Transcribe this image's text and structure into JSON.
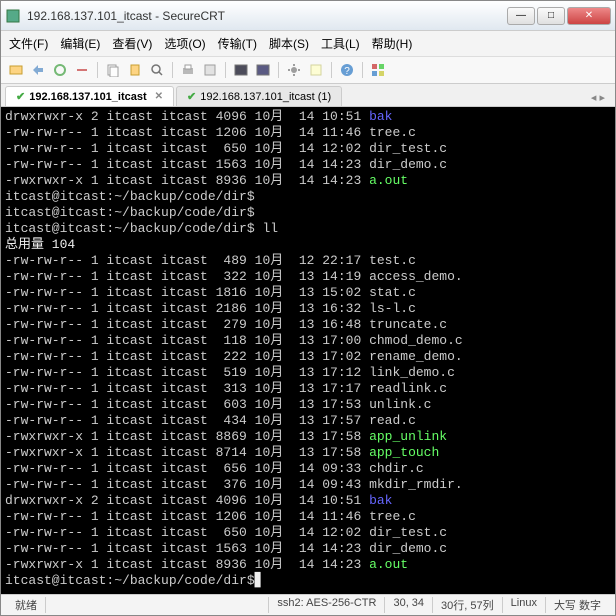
{
  "window": {
    "title": "192.168.137.101_itcast - SecureCRT"
  },
  "menubar": {
    "file": "文件(F)",
    "edit": "编辑(E)",
    "view": "查看(V)",
    "options": "选项(O)",
    "transfer": "传输(T)",
    "script": "脚本(S)",
    "tools": "工具(L)",
    "help": "帮助(H)"
  },
  "tabs": {
    "active": "192.168.137.101_itcast",
    "inactive": "192.168.137.101_itcast (1)"
  },
  "terminal": {
    "lines": [
      {
        "perm": "drwxrwxr-x",
        "n": "2",
        "u": "itcast",
        "g": "itcast",
        "size": "4096",
        "m": "10月",
        "d": "14",
        "t": "10:51",
        "name": "bak",
        "cls": "c-blue"
      },
      {
        "perm": "-rw-rw-r--",
        "n": "1",
        "u": "itcast",
        "g": "itcast",
        "size": "1206",
        "m": "10月",
        "d": "14",
        "t": "11:46",
        "name": "tree.c",
        "cls": ""
      },
      {
        "perm": "-rw-rw-r--",
        "n": "1",
        "u": "itcast",
        "g": "itcast",
        "size": " 650",
        "m": "10月",
        "d": "14",
        "t": "12:02",
        "name": "dir_test.c",
        "cls": ""
      },
      {
        "perm": "-rw-rw-r--",
        "n": "1",
        "u": "itcast",
        "g": "itcast",
        "size": "1563",
        "m": "10月",
        "d": "14",
        "t": "14:23",
        "name": "dir_demo.c",
        "cls": ""
      },
      {
        "perm": "-rwxrwxr-x",
        "n": "1",
        "u": "itcast",
        "g": "itcast",
        "size": "8936",
        "m": "10月",
        "d": "14",
        "t": "14:23",
        "name": "a.out",
        "cls": "c-green"
      }
    ],
    "prompts": [
      "itcast@itcast:~/backup/code/dir$",
      "itcast@itcast:~/backup/code/dir$",
      "itcast@itcast:~/backup/code/dir$ ll"
    ],
    "total": "总用量 104",
    "listing": [
      {
        "perm": "-rw-rw-r--",
        "n": "1",
        "u": "itcast",
        "g": "itcast",
        "size": " 489",
        "m": "10月",
        "d": "12",
        "t": "22:17",
        "name": "test.c",
        "cls": ""
      },
      {
        "perm": "-rw-rw-r--",
        "n": "1",
        "u": "itcast",
        "g": "itcast",
        "size": " 322",
        "m": "10月",
        "d": "13",
        "t": "14:19",
        "name": "access_demo.",
        "cls": ""
      },
      {
        "perm": "-rw-rw-r--",
        "n": "1",
        "u": "itcast",
        "g": "itcast",
        "size": "1816",
        "m": "10月",
        "d": "13",
        "t": "15:02",
        "name": "stat.c",
        "cls": ""
      },
      {
        "perm": "-rw-rw-r--",
        "n": "1",
        "u": "itcast",
        "g": "itcast",
        "size": "2186",
        "m": "10月",
        "d": "13",
        "t": "16:32",
        "name": "ls-l.c",
        "cls": ""
      },
      {
        "perm": "-rw-rw-r--",
        "n": "1",
        "u": "itcast",
        "g": "itcast",
        "size": " 279",
        "m": "10月",
        "d": "13",
        "t": "16:48",
        "name": "truncate.c",
        "cls": ""
      },
      {
        "perm": "-rw-rw-r--",
        "n": "1",
        "u": "itcast",
        "g": "itcast",
        "size": " 118",
        "m": "10月",
        "d": "13",
        "t": "17:00",
        "name": "chmod_demo.c",
        "cls": ""
      },
      {
        "perm": "-rw-rw-r--",
        "n": "1",
        "u": "itcast",
        "g": "itcast",
        "size": " 222",
        "m": "10月",
        "d": "13",
        "t": "17:02",
        "name": "rename_demo.",
        "cls": ""
      },
      {
        "perm": "-rw-rw-r--",
        "n": "1",
        "u": "itcast",
        "g": "itcast",
        "size": " 519",
        "m": "10月",
        "d": "13",
        "t": "17:12",
        "name": "link_demo.c",
        "cls": ""
      },
      {
        "perm": "-rw-rw-r--",
        "n": "1",
        "u": "itcast",
        "g": "itcast",
        "size": " 313",
        "m": "10月",
        "d": "13",
        "t": "17:17",
        "name": "readlink.c",
        "cls": ""
      },
      {
        "perm": "-rw-rw-r--",
        "n": "1",
        "u": "itcast",
        "g": "itcast",
        "size": " 603",
        "m": "10月",
        "d": "13",
        "t": "17:53",
        "name": "unlink.c",
        "cls": ""
      },
      {
        "perm": "-rw-rw-r--",
        "n": "1",
        "u": "itcast",
        "g": "itcast",
        "size": " 434",
        "m": "10月",
        "d": "13",
        "t": "17:57",
        "name": "read.c",
        "cls": ""
      },
      {
        "perm": "-rwxrwxr-x",
        "n": "1",
        "u": "itcast",
        "g": "itcast",
        "size": "8869",
        "m": "10月",
        "d": "13",
        "t": "17:58",
        "name": "app_unlink",
        "cls": "c-green"
      },
      {
        "perm": "-rwxrwxr-x",
        "n": "1",
        "u": "itcast",
        "g": "itcast",
        "size": "8714",
        "m": "10月",
        "d": "13",
        "t": "17:58",
        "name": "app_touch",
        "cls": "c-green"
      },
      {
        "perm": "-rw-rw-r--",
        "n": "1",
        "u": "itcast",
        "g": "itcast",
        "size": " 656",
        "m": "10月",
        "d": "14",
        "t": "09:33",
        "name": "chdir.c",
        "cls": ""
      },
      {
        "perm": "-rw-rw-r--",
        "n": "1",
        "u": "itcast",
        "g": "itcast",
        "size": " 376",
        "m": "10月",
        "d": "14",
        "t": "09:43",
        "name": "mkdir_rmdir.",
        "cls": ""
      },
      {
        "perm": "drwxrwxr-x",
        "n": "2",
        "u": "itcast",
        "g": "itcast",
        "size": "4096",
        "m": "10月",
        "d": "14",
        "t": "10:51",
        "name": "bak",
        "cls": "c-blue"
      },
      {
        "perm": "-rw-rw-r--",
        "n": "1",
        "u": "itcast",
        "g": "itcast",
        "size": "1206",
        "m": "10月",
        "d": "14",
        "t": "11:46",
        "name": "tree.c",
        "cls": ""
      },
      {
        "perm": "-rw-rw-r--",
        "n": "1",
        "u": "itcast",
        "g": "itcast",
        "size": " 650",
        "m": "10月",
        "d": "14",
        "t": "12:02",
        "name": "dir_test.c",
        "cls": ""
      },
      {
        "perm": "-rw-rw-r--",
        "n": "1",
        "u": "itcast",
        "g": "itcast",
        "size": "1563",
        "m": "10月",
        "d": "14",
        "t": "14:23",
        "name": "dir_demo.c",
        "cls": ""
      },
      {
        "perm": "-rwxrwxr-x",
        "n": "1",
        "u": "itcast",
        "g": "itcast",
        "size": "8936",
        "m": "10月",
        "d": "14",
        "t": "14:23",
        "name": "a.out",
        "cls": "c-green"
      }
    ],
    "last_prompt": "itcast@itcast:~/backup/code/dir$"
  },
  "statusbar": {
    "ready": "就绪",
    "encryption": "ssh2: AES-256-CTR",
    "cursor": "30, 34",
    "size": "30行, 57列",
    "term": "Linux",
    "caps": "大写 数字"
  }
}
